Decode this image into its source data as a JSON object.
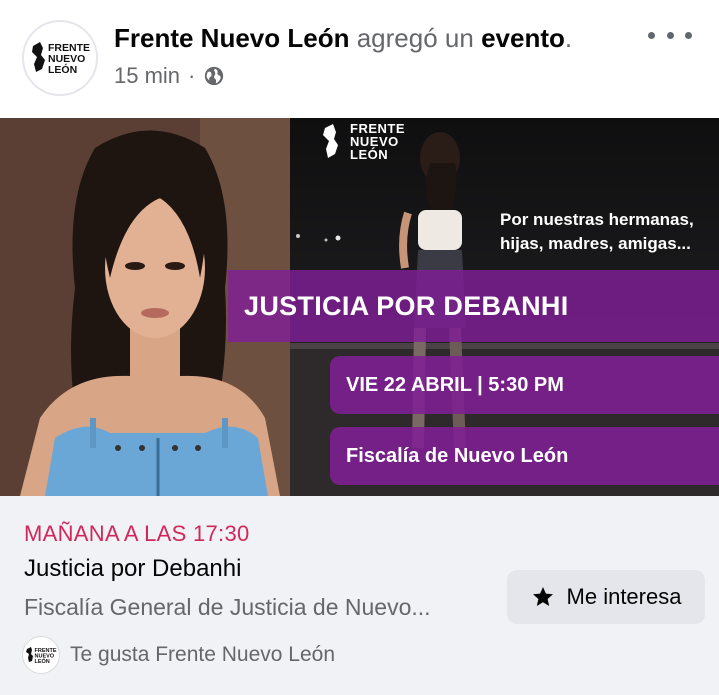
{
  "post": {
    "page_name": "Frente Nuevo León",
    "action_text": "agregó un",
    "object_text": "evento",
    "period": ".",
    "time": "15 min",
    "separator": "·",
    "audience_icon": "globe-icon",
    "more_icon": "more-horizontal-icon"
  },
  "logo": {
    "line1": "FRENTE",
    "line2": "NUEVO",
    "line3": "LEÓN"
  },
  "banner": {
    "tagline_1": "Por nuestras hermanas,",
    "tagline_2": "hijas, madres, amigas...",
    "headline": "JUSTICIA POR DEBANHI",
    "date_time": "VIE 22 ABRIL | 5:30 PM",
    "place": "Fiscalía de Nuevo León",
    "purple": "#801e96"
  },
  "event": {
    "when": "MAÑANA A LAS 17:30",
    "title": "Justicia por Debanhi",
    "location": "Fiscalía General de Justicia de Nuevo...",
    "interest_label": "Me interesa",
    "interest_icon": "star-icon",
    "accent": "#d0285a"
  },
  "footer": {
    "likes_text": "Te gusta Frente Nuevo León"
  }
}
